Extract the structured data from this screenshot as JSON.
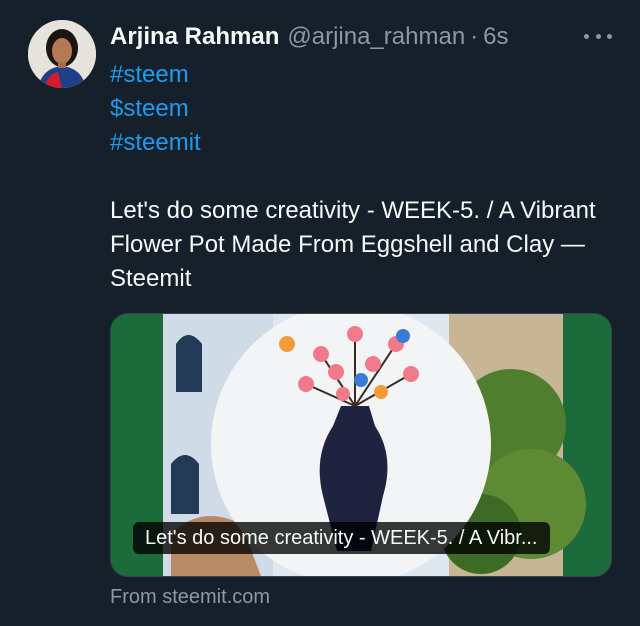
{
  "tweet": {
    "display_name": "Arjina Rahman",
    "handle": "@arjina_rahman",
    "separator": "·",
    "time": "6s",
    "hashtags": [
      "#steem",
      "$steem",
      "#steemit"
    ],
    "text": "Let's do some creativity - WEEK-5. / A Vibrant Flower Pot  Made From Eggshell and Clay — Steemit"
  },
  "card": {
    "caption": "Let's do some creativity - WEEK-5. / A Vibr...",
    "source": "From steemit.com"
  },
  "icons": {
    "more": "more-horizontal-icon"
  },
  "colors": {
    "background": "#15202b",
    "link": "#1d9bf0",
    "muted": "#8b98a5"
  }
}
